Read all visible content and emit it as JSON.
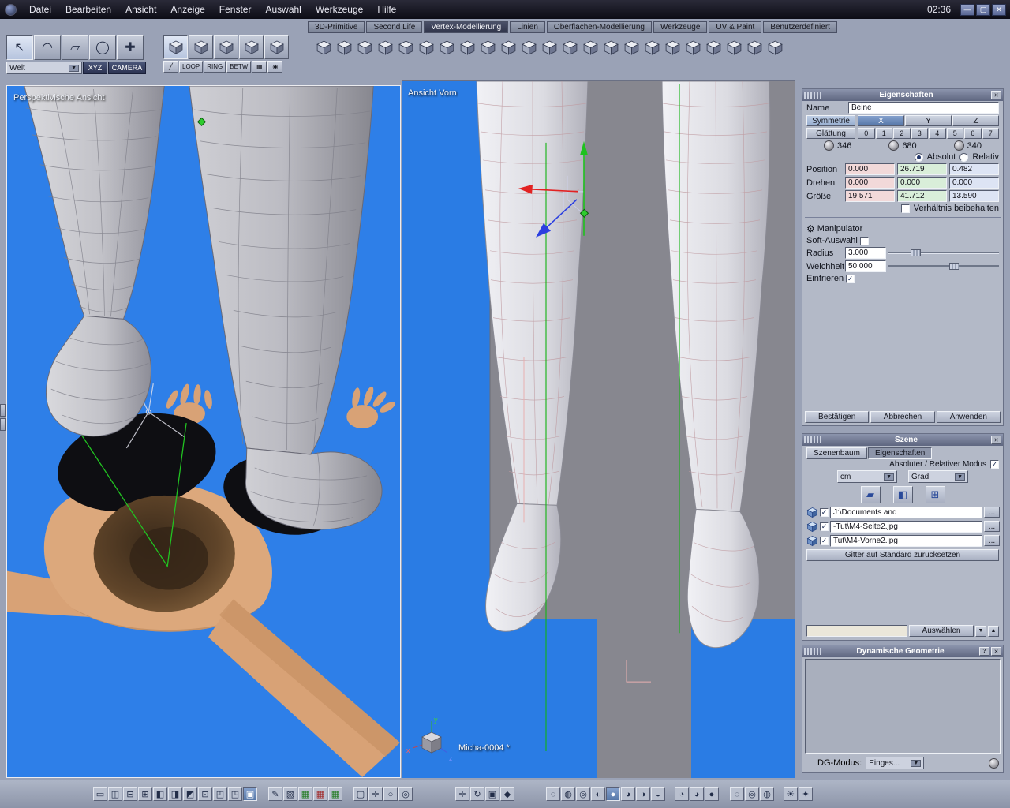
{
  "window": {
    "clock": "02:36",
    "controls": [
      {
        "name": "minimize-button",
        "glyph": "—"
      },
      {
        "name": "maximize-button",
        "glyph": "▢"
      },
      {
        "name": "close-button",
        "glyph": "✕"
      }
    ]
  },
  "ui": {
    "close_glyph": "✕",
    "help_glyph": "?",
    "dropdown_glyph": "▼",
    "spin_up_glyph": "▲",
    "spin_down_glyph": "▼",
    "manipulator_glyph": "⚙"
  },
  "menubar": {
    "items": [
      {
        "label": "Datei"
      },
      {
        "label": "Bearbeiten"
      },
      {
        "label": "Ansicht"
      },
      {
        "label": "Anzeige"
      },
      {
        "label": "Fenster"
      },
      {
        "label": "Auswahl"
      },
      {
        "label": "Werkzeuge"
      },
      {
        "label": "Hilfe"
      }
    ]
  },
  "tabbar": {
    "items": [
      {
        "label": "3D-Primitive"
      },
      {
        "label": "Second Life"
      },
      {
        "label": "Vertex-Modellierung",
        "active": true
      },
      {
        "label": "Linien"
      },
      {
        "label": "Oberflächen-Modellierung"
      },
      {
        "label": "Werkzeuge"
      },
      {
        "label": "UV & Paint"
      },
      {
        "label": "Benutzerdefiniert"
      }
    ]
  },
  "select_palette": {
    "tools": [
      {
        "name": "select-arrow-icon",
        "glyph": "↖",
        "active": true
      },
      {
        "name": "curve-select-icon",
        "glyph": "◠"
      },
      {
        "name": "rect-select-icon",
        "glyph": "▱"
      },
      {
        "name": "circle-select-icon",
        "glyph": "◯"
      },
      {
        "name": "add-select-icon",
        "glyph": "✚"
      }
    ],
    "world_label": "Welt",
    "xyz_label": "XYZ",
    "camera_label": "CAMERA"
  },
  "mode_palette": {
    "modes": [
      {
        "name": "vertex-mode-icon",
        "active": true
      },
      {
        "name": "edge-mode-icon"
      },
      {
        "name": "face-mode-icon"
      },
      {
        "name": "object-mode-icon"
      },
      {
        "name": "uv-mode-icon"
      }
    ],
    "loop_label": "LOOP",
    "ring_label": "RING",
    "betw_label": "BETW",
    "edge_tools": [
      {
        "name": "edge-loop-icon",
        "glyph": "╱"
      },
      {
        "name": "grow-selection-icon",
        "glyph": "▦"
      },
      {
        "name": "shrink-selection-icon",
        "glyph": "◉"
      }
    ]
  },
  "main_toolbar": {
    "tools": [
      {
        "name": "move-vertex-tool-icon"
      },
      {
        "name": "extract-tool-icon"
      },
      {
        "name": "extrude-face-tool-icon"
      },
      {
        "name": "extrude-edge-tool-icon"
      },
      {
        "name": "sweep-surface-tool-icon"
      },
      {
        "name": "smooth-tool-icon"
      },
      {
        "name": "tessellate-tool-icon"
      },
      {
        "name": "connect-points-tool-icon"
      },
      {
        "name": "dissolve-tool-icon"
      },
      {
        "name": "weld-points-tool-icon"
      },
      {
        "name": "average-weld-tool-icon"
      },
      {
        "name": "bridge-tool-icon"
      },
      {
        "name": "close-hole-tool-icon"
      },
      {
        "name": "symmetry-tool-icon"
      },
      {
        "name": "copy-symmetry-tool-icon"
      },
      {
        "name": "thickness-tool-icon"
      },
      {
        "name": "chamfer-tool-icon"
      },
      {
        "name": "facet-tool-icon"
      },
      {
        "name": "triangulate-tool-icon"
      },
      {
        "name": "decimate-tool-icon"
      },
      {
        "name": "add-point-tool-icon"
      },
      {
        "name": "flip-normal-tool-icon"
      },
      {
        "name": "magnet-tool-icon"
      }
    ]
  },
  "viewports": {
    "perspective": {
      "title": "Perspektivische Ansicht"
    },
    "front": {
      "title": "Ansicht Vorn",
      "document_label": "Micha-0004 *"
    }
  },
  "properties": {
    "title": "Eigenschaften",
    "name_label": "Name",
    "name_value": "Beine",
    "symmetry_label": "Symmetrie",
    "axes": [
      {
        "label": "X",
        "active": true
      },
      {
        "label": "Y"
      },
      {
        "label": "Z"
      }
    ],
    "smoothing_label": "Glättung",
    "smoothing_levels": [
      "0",
      "1",
      "2",
      "3",
      "4",
      "5",
      "6",
      "7"
    ],
    "counts": [
      {
        "name": "point-count",
        "value": "346"
      },
      {
        "name": "edge-count",
        "value": "680"
      },
      {
        "name": "face-count",
        "value": "340"
      }
    ],
    "absolute_label": "Absolut",
    "relative_label": "Relativ",
    "position_label": "Position",
    "position": [
      "0.000",
      "26.719",
      "0.482"
    ],
    "rotation_label": "Drehen",
    "rotation": [
      "0.000",
      "0.000",
      "0.000"
    ],
    "size_label": "Größe",
    "size": [
      "19.571",
      "41.712",
      "13.590"
    ],
    "keep_ratio_label": "Verhältnis beibehalten",
    "manipulator_label": "Manipulator",
    "soft_select_label": "Soft-Auswahl",
    "radius_label": "Radius",
    "radius_value": "3.000",
    "softness_label": "Weichheit",
    "softness_value": "50.000",
    "freeze_label": "Einfrieren",
    "confirm_label": "Bestätigen",
    "cancel_label": "Abbrechen",
    "apply_label": "Anwenden"
  },
  "scene": {
    "title": "Szene",
    "tabs": [
      {
        "label": "Szenenbaum"
      },
      {
        "label": "Eigenschaften",
        "active": true
      }
    ],
    "mode_label": "Absoluter / Relativer Modus",
    "unit_value": "cm",
    "angle_value": "Grad",
    "icon_buttons": [
      {
        "name": "eraser-icon",
        "glyph": "▰"
      },
      {
        "name": "material-cube-icon",
        "glyph": "◧"
      },
      {
        "name": "calculator-icon",
        "glyph": "⊞"
      }
    ],
    "layers": [
      {
        "label": "J:\\Documents and"
      },
      {
        "label": "-Tut\\M4-Seite2.jpg"
      },
      {
        "label": "Tut\\M4-Vorne2.jpg"
      }
    ],
    "more_label": "...",
    "reset_grid_label": "Gitter auf Standard zurücksetzen",
    "select_label": "Auswählen"
  },
  "dynamic_geometry": {
    "title": "Dynamische Geometrie",
    "mode_label": "DG-Modus:",
    "mode_value": "Einges..."
  },
  "bottom_toolbar": {
    "layout_tools": [
      {
        "name": "layout-full-icon",
        "glyph": "▭"
      },
      {
        "name": "layout-split-v-icon",
        "glyph": "◫"
      },
      {
        "name": "layout-split-h-icon",
        "glyph": "⊟"
      },
      {
        "name": "layout-quad-icon",
        "glyph": "⊞"
      },
      {
        "name": "layout-left-icon",
        "glyph": "◧"
      },
      {
        "name": "layout-right-icon",
        "glyph": "◨"
      },
      {
        "name": "layout-corner-icon",
        "glyph": "◩"
      },
      {
        "name": "layout-center-icon",
        "glyph": "⊡"
      },
      {
        "name": "layout-three-left-icon",
        "glyph": "◰"
      },
      {
        "name": "layout-three-right-icon",
        "glyph": "◳"
      },
      {
        "name": "layout-single-icon",
        "glyph": "▣",
        "active": true
      }
    ],
    "grid_tools": [
      {
        "name": "draw-grid-icon",
        "glyph": "✎"
      },
      {
        "name": "texture-grid-icon",
        "glyph": "▧"
      },
      {
        "name": "grid-xy-icon",
        "glyph": "▦",
        "color": "#1f7a1f"
      },
      {
        "name": "grid-xz-icon",
        "glyph": "▦",
        "color": "#a02828"
      },
      {
        "name": "grid-yz-icon",
        "glyph": "▦",
        "color": "#1f7a1f"
      }
    ],
    "view_tools": [
      {
        "name": "frame-select-icon",
        "glyph": "▢"
      },
      {
        "name": "pan-view-icon",
        "glyph": "✛"
      },
      {
        "name": "zoom-view-icon",
        "glyph": "○"
      },
      {
        "name": "center-view-icon",
        "glyph": "◎"
      }
    ],
    "manipulator_tools": [
      {
        "name": "translate-manipulator-icon",
        "glyph": "✛"
      },
      {
        "name": "rotate-manipulator-icon",
        "glyph": "↻"
      },
      {
        "name": "scale-manipulator-icon",
        "glyph": "▣"
      },
      {
        "name": "snap-manipulator-icon",
        "glyph": "◆"
      }
    ],
    "display_tools": [
      {
        "name": "wireframe-display-icon",
        "glyph": "◌"
      },
      {
        "name": "hidden-line-display-icon",
        "glyph": "◍"
      },
      {
        "name": "flat-display-icon",
        "glyph": "◎"
      },
      {
        "name": "flat-wire-display-icon",
        "glyph": "◐"
      },
      {
        "name": "smooth-display-icon",
        "glyph": "●",
        "active": true
      },
      {
        "name": "smooth-wire-display-icon",
        "glyph": "◕"
      },
      {
        "name": "textured-display-icon",
        "glyph": "◑"
      },
      {
        "name": "textured-wire-display-icon",
        "glyph": "◒"
      }
    ],
    "shading_tools": [
      {
        "name": "shade-selection-icon",
        "glyph": "◔"
      },
      {
        "name": "shade-object-icon",
        "glyph": "◕"
      },
      {
        "name": "shade-scene-icon",
        "glyph": "●"
      }
    ],
    "wire_tools": [
      {
        "name": "wire-sphere-icon",
        "glyph": "◌"
      },
      {
        "name": "wire-shaded-icon",
        "glyph": "◎"
      },
      {
        "name": "wire-hidden-icon",
        "glyph": "◍"
      }
    ],
    "light_tools": [
      {
        "name": "light-icon",
        "glyph": "☀"
      },
      {
        "name": "render-icon",
        "glyph": "✦"
      }
    ]
  }
}
